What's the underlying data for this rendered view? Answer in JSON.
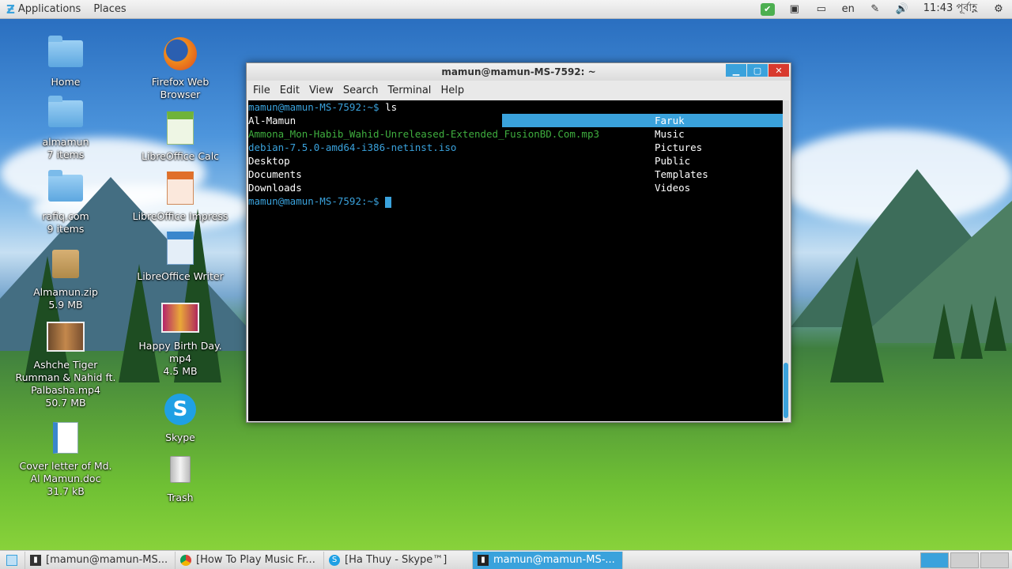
{
  "top_panel": {
    "applications_label": "Applications",
    "places_label": "Places",
    "keyboard_layout": "en",
    "clock": "11:43 পূর্বাহ্ণ"
  },
  "desktop": {
    "icons": [
      {
        "label": "Home"
      },
      {
        "label": "Firefox Web\nBrowser"
      },
      {
        "label": "almamun\n7 items"
      },
      {
        "label": "LibreOffice Calc"
      },
      {
        "label": "rafiq.com\n9 items"
      },
      {
        "label": "LibreOffice Impress"
      },
      {
        "label": "Almamun.zip\n5.9 MB"
      },
      {
        "label": "LibreOffice Writer"
      },
      {
        "label": "Happy Birth Day.\nmp4\n4.5 MB"
      },
      {
        "label": "Ashche Tiger\nRumman & Nahid ft.\nPalbasha.mp4\n50.7 MB"
      },
      {
        "label": "Skype"
      },
      {
        "label": "Cover letter of Md.\nAl Mamun.doc\n31.7 kB"
      },
      {
        "label": "Trash"
      }
    ]
  },
  "terminal": {
    "title": "mamun@mamun-MS-7592: ~",
    "menu": [
      "File",
      "Edit",
      "View",
      "Search",
      "Terminal",
      "Help"
    ],
    "prompt": "mamun@mamun-MS-7592:~$",
    "command": " ls",
    "left_column": [
      {
        "text": "Al-Mamun",
        "color": "white"
      },
      {
        "text": "Ammona_Mon-Habib_Wahid-Unreleased-Extended_FusionBD.Com.mp3",
        "color": "green"
      },
      {
        "text": "debian-7.5.0-amd64-i386-netinst.iso",
        "color": "blue"
      },
      {
        "text": "Desktop",
        "color": "white"
      },
      {
        "text": "Documents",
        "color": "white"
      },
      {
        "text": "Downloads",
        "color": "white"
      }
    ],
    "right_column": [
      "Faruk",
      "Music",
      "Pictures",
      "Public",
      "Templates",
      "Videos"
    ],
    "accent_color": "#3aa2dc"
  },
  "taskbar": {
    "tasks": [
      {
        "label": "[mamun@mamun-MS...",
        "active": false,
        "icon": "terminal-icon"
      },
      {
        "label": "[How To Play Music Fr...",
        "active": false,
        "icon": "chrome-icon"
      },
      {
        "label": "[Ha Thuy - Skype™]",
        "active": false,
        "icon": "skype-icon"
      },
      {
        "label": "mamun@mamun-MS-...",
        "active": true,
        "icon": "terminal-icon"
      }
    ]
  }
}
